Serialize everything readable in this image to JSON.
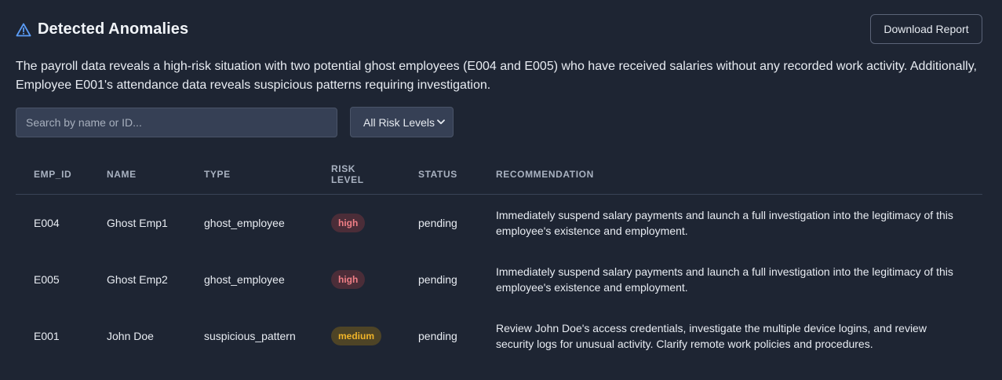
{
  "header": {
    "title": "Detected Anomalies",
    "download_label": "Download Report"
  },
  "summary": "The payroll data reveals a high-risk situation with two potential ghost employees (E004 and E005) who have received salaries without any recorded work activity. Additionally, Employee E001's attendance data reveals suspicious patterns requiring investigation.",
  "filters": {
    "search_placeholder": "Search by name or ID...",
    "search_value": "",
    "risk_selected": "All Risk Levels"
  },
  "table": {
    "columns": {
      "emp_id": "EMP_ID",
      "name": "NAME",
      "type": "TYPE",
      "risk": "RISK LEVEL",
      "status": "STATUS",
      "recommendation": "RECOMMENDATION"
    },
    "rows": [
      {
        "emp_id": "E004",
        "name": "Ghost Emp1",
        "type": "ghost_employee",
        "risk": "high",
        "status": "pending",
        "recommendation": "Immediately suspend salary payments and launch a full investigation into the legitimacy of this employee's existence and employment."
      },
      {
        "emp_id": "E005",
        "name": "Ghost Emp2",
        "type": "ghost_employee",
        "risk": "high",
        "status": "pending",
        "recommendation": "Immediately suspend salary payments and launch a full investigation into the legitimacy of this employee's existence and employment."
      },
      {
        "emp_id": "E001",
        "name": "John Doe",
        "type": "suspicious_pattern",
        "risk": "medium",
        "status": "pending",
        "recommendation": "Review John Doe's access credentials, investigate the multiple device logins, and review security logs for unusual activity. Clarify remote work policies and procedures."
      }
    ]
  },
  "colors": {
    "background": "#1e2533",
    "accent_icon": "#5b9cf6",
    "high_badge_text": "#f07f86",
    "medium_badge_text": "#f0b429"
  },
  "icons": {
    "title_icon": "warning-triangle-icon",
    "select_icon": "chevron-down-icon"
  }
}
